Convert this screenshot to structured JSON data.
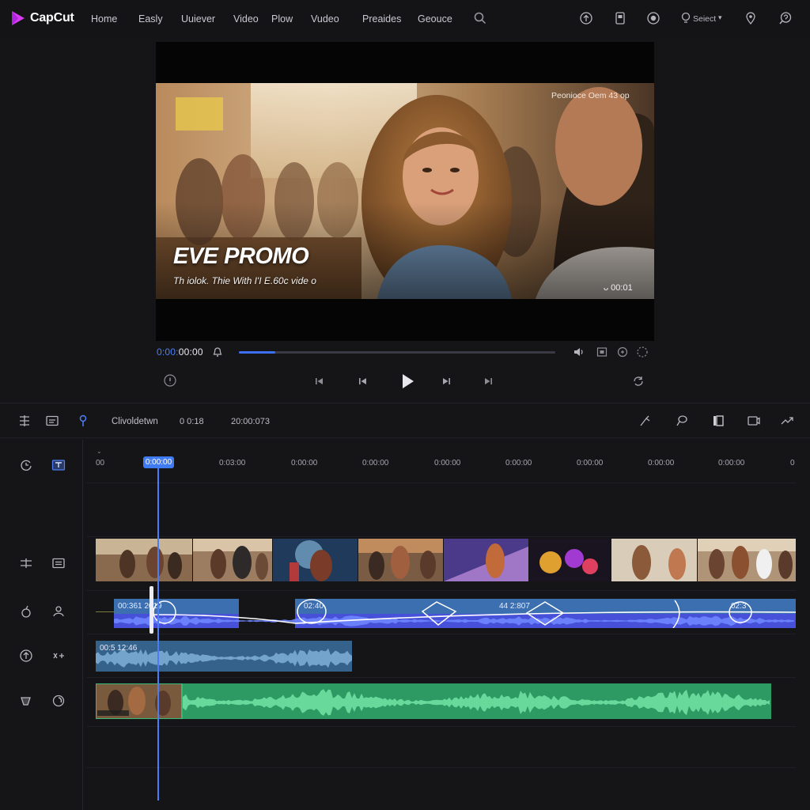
{
  "app": {
    "brand": "CapCut",
    "accent_color": "#3f7bf2",
    "logo_color": "#d63cf0"
  },
  "nav": {
    "items": [
      "Home",
      "Easly",
      "Uuiever",
      "Video",
      "Plow",
      "Vudeo",
      "Preaides",
      "Geouce"
    ],
    "right_icons": [
      "search-icon",
      "upload-icon",
      "document-icon",
      "globe-icon",
      "bulb-icon",
      "location-icon",
      "help-icon"
    ],
    "select_label": "Seiect",
    "select_caret": "▾"
  },
  "preview": {
    "title": "EVE PROMO",
    "subtitle": "Th iolok. Thie With I'I E.60c vide o",
    "overlay_top_right": "Peonioce Oem 43 op",
    "overlay_bottom_right": "ᴗ 00:01"
  },
  "player": {
    "timecode_prefix": "0:00:",
    "timecode_suffix": "00:00",
    "progress": 0.115,
    "icons": [
      "volume-icon",
      "skip-start-icon",
      "previous-frame-icon",
      "play-icon",
      "next-frame-icon",
      "skip-end-icon",
      "speaker-icon",
      "fit-icon",
      "crop-icon",
      "fullscreen-icon",
      "info-icon",
      "loop-icon"
    ]
  },
  "timeline": {
    "toolbar_label": "Clivoldetwn",
    "time_a": "0 0:18",
    "time_b": "20:00:073",
    "toolbar_icons": [
      "split-icon",
      "caption-icon",
      "marker-icon",
      "cut-icon",
      "lasso-icon",
      "freeze-icon",
      "crop-frame-icon",
      "share-icon"
    ],
    "ruler_labels": [
      "00",
      "0:03:00",
      "0:00:00",
      "0:00:00",
      "0:00:00",
      "0:00:00",
      "0:00:00",
      "0:00:00",
      "0:00:00",
      "0"
    ],
    "playhead_label": "0:00:00",
    "audio1_label_a": "00:361 2019",
    "audio1_label_b": "02:40",
    "audio1_label_c": "44 2:807",
    "audio1_label_d": "02:3",
    "audio2_label": "00:5 12:46",
    "video_clip_count": 9,
    "audio1_color": "#3b5bd6",
    "audio2_color": "#3d6d96",
    "audio3_color": "#2fa86a"
  },
  "sidebar": {
    "icons": [
      "sync-icon",
      "text-box-icon",
      "adjust-icon",
      "caption-track-icon",
      "effects-icon",
      "sticker-icon",
      "audio-icon",
      "voice-icon",
      "music-icon",
      "record-icon"
    ]
  }
}
